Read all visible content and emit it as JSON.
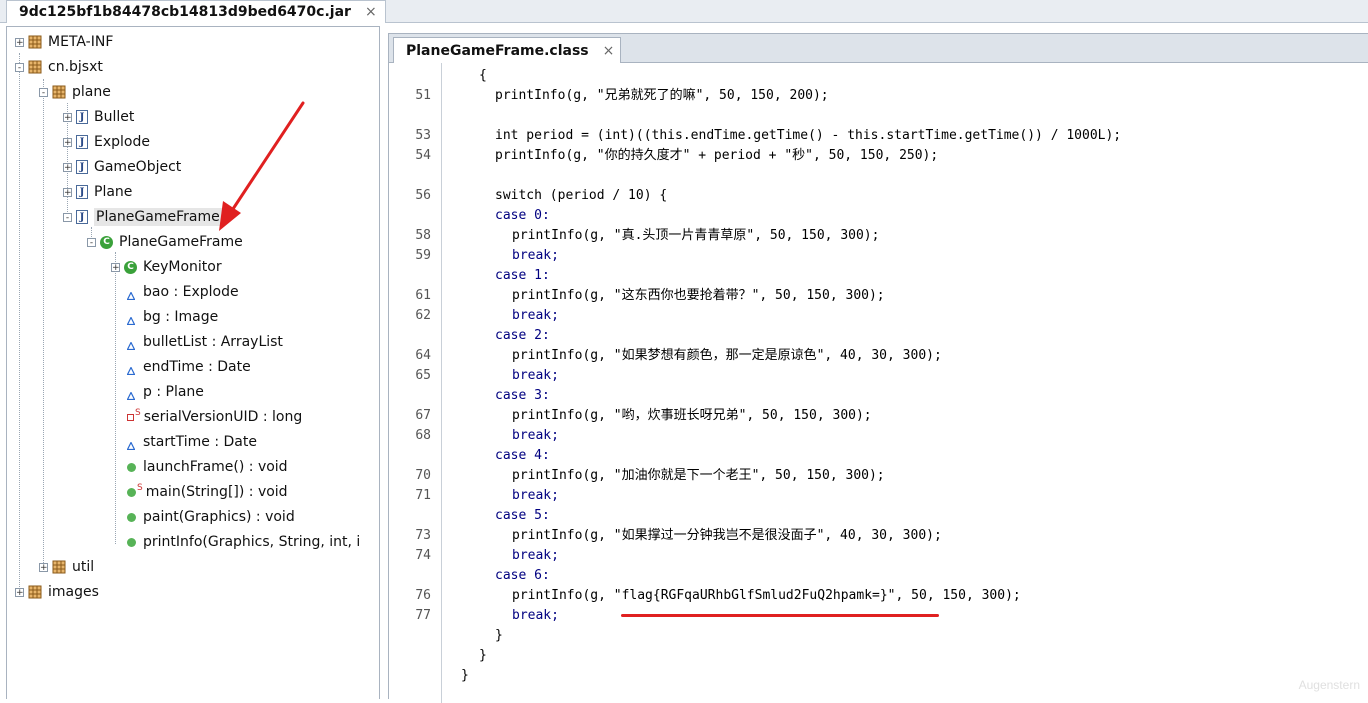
{
  "top_tab": {
    "title": "9dc125bf1b84478cb14813d9bed6470c.jar",
    "close": "×"
  },
  "tree": {
    "nodes": [
      {
        "label": "META-INF",
        "toggle": "+"
      },
      {
        "label": "cn.bjsxt",
        "toggle": "-"
      },
      {
        "label": "plane",
        "toggle": "-"
      },
      {
        "label": "Bullet",
        "toggle": "+"
      },
      {
        "label": "Explode",
        "toggle": "+"
      },
      {
        "label": "GameObject",
        "toggle": "+"
      },
      {
        "label": "Plane",
        "toggle": "+"
      },
      {
        "label": "PlaneGameFrame",
        "toggle": "-"
      },
      {
        "label": "PlaneGameFrame",
        "toggle": "-"
      },
      {
        "label": "KeyMonitor",
        "toggle": "+"
      },
      {
        "label": "bao : Explode"
      },
      {
        "label": "bg : Image"
      },
      {
        "label": "bulletList : ArrayList"
      },
      {
        "label": "endTime : Date"
      },
      {
        "label": "p : Plane"
      },
      {
        "label": "serialVersionUID : long",
        "sup": "S"
      },
      {
        "label": "startTime : Date"
      },
      {
        "label": "launchFrame() : void"
      },
      {
        "label": "main(String[]) : void",
        "sup": "S"
      },
      {
        "label": "paint(Graphics) : void"
      },
      {
        "label": "printInfo(Graphics, String, int, i"
      },
      {
        "label": "util",
        "toggle": "+"
      },
      {
        "label": "images",
        "toggle": "+"
      }
    ],
    "icon_letters": {
      "java_file": "J",
      "class": "C"
    }
  },
  "editor": {
    "tab": {
      "title": "PlaneGameFrame.class",
      "close": "×"
    },
    "line_numbers": [
      "51",
      "53",
      "54",
      "56",
      "58",
      "59",
      "61",
      "62",
      "64",
      "65",
      "67",
      "68",
      "70",
      "71",
      "73",
      "74",
      "76",
      "77"
    ],
    "code": [
      "{",
      "printInfo(g, \"兄弟就死了的嘛\", 50, 150, 200);",
      "int period = (int)((this.endTime.getTime() - this.startTime.getTime()) / 1000L);",
      "printInfo(g, \"你的持久度才\" + period + \"秒\", 50, 150, 250);",
      "switch (period / 10) {",
      "case 0:",
      "printInfo(g, \"真.头顶一片青青草原\", 50, 150, 300);",
      "break;",
      "case 1:",
      "printInfo(g, \"这东西你也要抢着带？\", 50, 150, 300);",
      "break;",
      "case 2:",
      "printInfo(g, \"如果梦想有颜色，那一定是原谅色\", 40, 30, 300);",
      "break;",
      "case 3:",
      "printInfo(g, \"哟，炊事班长呀兄弟\", 50, 150, 300);",
      "break;",
      "case 4:",
      "printInfo(g, \"加油你就是下一个老王\", 50, 150, 300);",
      "break;",
      "case 5:",
      "printInfo(g, \"如果撑过一分钟我岂不是很没面子\", 40, 30, 300);",
      "break;",
      "case 6:",
      "printInfo(g, \"flag{RGFqaURhbGlfSmlud2FuQ2hpamk=}\", 50, 150, 300);",
      "break;",
      "}",
      "}",
      "}"
    ]
  },
  "watermark": "Augenstern",
  "colors": {
    "annotation_red": "#e02020",
    "string_blue": "#2a00ff",
    "keyword_navy": "#000080"
  }
}
